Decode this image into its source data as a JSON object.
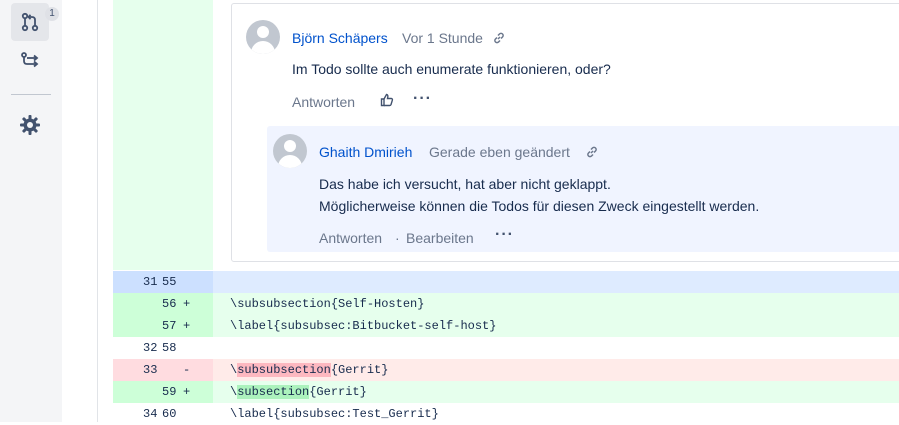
{
  "sidebar": {
    "pullrequest_badge": "1",
    "items": [
      {
        "icon": "pull-request-icon"
      },
      {
        "icon": "commits-icon"
      },
      {
        "icon": "gear-icon"
      }
    ]
  },
  "comment": {
    "author": "Björn Schäpers",
    "time": "Vor 1 Stunde",
    "text": "Im Todo sollte auch enumerate funktionieren, oder?",
    "reply_label": "Antworten",
    "reply": {
      "author": "Ghaith Dmirieh",
      "time": "Gerade eben geändert",
      "line1": "Das habe ich versucht, hat aber nicht geklappt.",
      "line2": "Möglicherweise können die Todos für diesen Zweck eingestellt werden.",
      "reply_label": "Antworten",
      "separator": "·",
      "edit_label": "Bearbeiten"
    }
  },
  "diff": {
    "rows": [
      {
        "old": "31",
        "new": "55",
        "sign": "",
        "code": "",
        "type": "context-hl"
      },
      {
        "old": "",
        "new": "56",
        "sign": "+",
        "code": "\\subsubsection{Self-Hosten}",
        "type": "add"
      },
      {
        "old": "",
        "new": "57",
        "sign": "+",
        "code": "\\label{subsubsec:Bitbucket-self-host}",
        "type": "add"
      },
      {
        "old": "32",
        "new": "58",
        "sign": "",
        "code": "",
        "type": "context"
      },
      {
        "old": "33",
        "new": "",
        "sign": "-",
        "code_pre": "\\",
        "code_hl": "subsubsection",
        "code_post": "{Gerrit}",
        "type": "del"
      },
      {
        "old": "",
        "new": "59",
        "sign": "+",
        "code_pre": "\\",
        "code_hl": "subsection",
        "code_post": "{Gerrit}",
        "type": "add"
      },
      {
        "old": "34",
        "new": "60",
        "sign": "",
        "code": "\\label{subsubsec:Test_Gerrit}",
        "type": "context"
      }
    ]
  },
  "colors": {
    "link": "#0052cc",
    "add_bg": "#e6ffed",
    "del_bg": "#ffebe9",
    "context_hl": "#deebff"
  }
}
